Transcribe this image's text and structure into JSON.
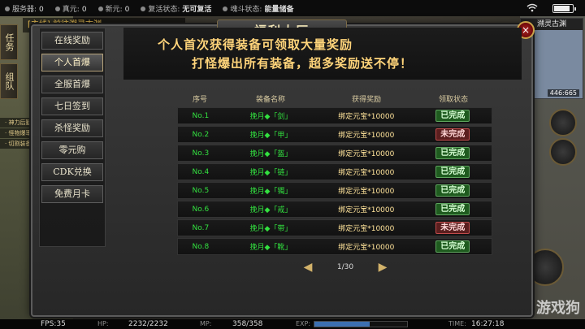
{
  "topbar": {
    "items": [
      {
        "label": "服务器:",
        "value": "0"
      },
      {
        "label": "真元:",
        "value": "0"
      },
      {
        "label": "新元:",
        "value": "0"
      },
      {
        "label": "复活状态:",
        "value": "无可复活",
        "style": "red"
      },
      {
        "label": "魂斗状态:",
        "value": "能量储备",
        "style": "green"
      }
    ]
  },
  "quest": {
    "text": "[主线] 前往溯灵古渊"
  },
  "lefttabs": [
    "任务",
    "组队"
  ],
  "sidebuttons": [
    "· 神力后勤",
    "· 怪物爆率",
    "· 切割装备"
  ],
  "minimap": {
    "title": "溯灵古渊",
    "coord": "446:665"
  },
  "panel": {
    "title": "福利大厅",
    "close": "×",
    "menu": [
      {
        "label": "在线奖励",
        "active": false
      },
      {
        "label": "个人首爆",
        "active": true
      },
      {
        "label": "全服首爆",
        "active": false
      },
      {
        "label": "七日签到",
        "active": false
      },
      {
        "label": "杀怪奖励",
        "active": false
      },
      {
        "label": "零元购",
        "active": false
      },
      {
        "label": "CDK兑换",
        "active": false
      },
      {
        "label": "免费月卡",
        "active": false
      }
    ],
    "banner": {
      "line1": "个人首次获得装备可领取大量奖励",
      "line2": "打怪爆出所有装备，超多奖励送不停！"
    },
    "table": {
      "headers": [
        "序号",
        "装备名称",
        "获得奖励",
        "领取状态"
      ],
      "rows": [
        {
          "no": "No.1",
          "name": "挽月◆「剑」",
          "reward": "绑定元宝*10000",
          "status": "已完成",
          "done": true
        },
        {
          "no": "No.2",
          "name": "挽月◆「甲」",
          "reward": "绑定元宝*10000",
          "status": "未完成",
          "done": false
        },
        {
          "no": "No.3",
          "name": "挽月◆「盔」",
          "reward": "绑定元宝*10000",
          "status": "已完成",
          "done": true
        },
        {
          "no": "No.4",
          "name": "挽月◆「链」",
          "reward": "绑定元宝*10000",
          "status": "已完成",
          "done": true
        },
        {
          "no": "No.5",
          "name": "挽月◆「镯」",
          "reward": "绑定元宝*10000",
          "status": "已完成",
          "done": true
        },
        {
          "no": "No.6",
          "name": "挽月◆「戒」",
          "reward": "绑定元宝*10000",
          "status": "已完成",
          "done": true
        },
        {
          "no": "No.7",
          "name": "挽月◆「带」",
          "reward": "绑定元宝*10000",
          "status": "未完成",
          "done": false
        },
        {
          "no": "No.8",
          "name": "挽月◆「靴」",
          "reward": "绑定元宝*10000",
          "status": "已完成",
          "done": true
        }
      ]
    },
    "pager": {
      "text": "1/30",
      "prev": "◀",
      "next": "▶"
    }
  },
  "bottombar": {
    "fps": "FPS:35",
    "hp_label": "HP:",
    "hp_value": "2232/2232",
    "mp_label": "MP:",
    "mp_value": "358/358",
    "exp_label": "EXP:",
    "time_label": "TIME:",
    "time_value": "16:27:18",
    "exp_fraction": 0.6
  },
  "watermark": "游戏狗",
  "colors": {
    "done_green": "#1f5b1f",
    "todo_red": "#5b1f1f",
    "gold_text": "#ffd47a",
    "green_text": "#32e03f"
  }
}
